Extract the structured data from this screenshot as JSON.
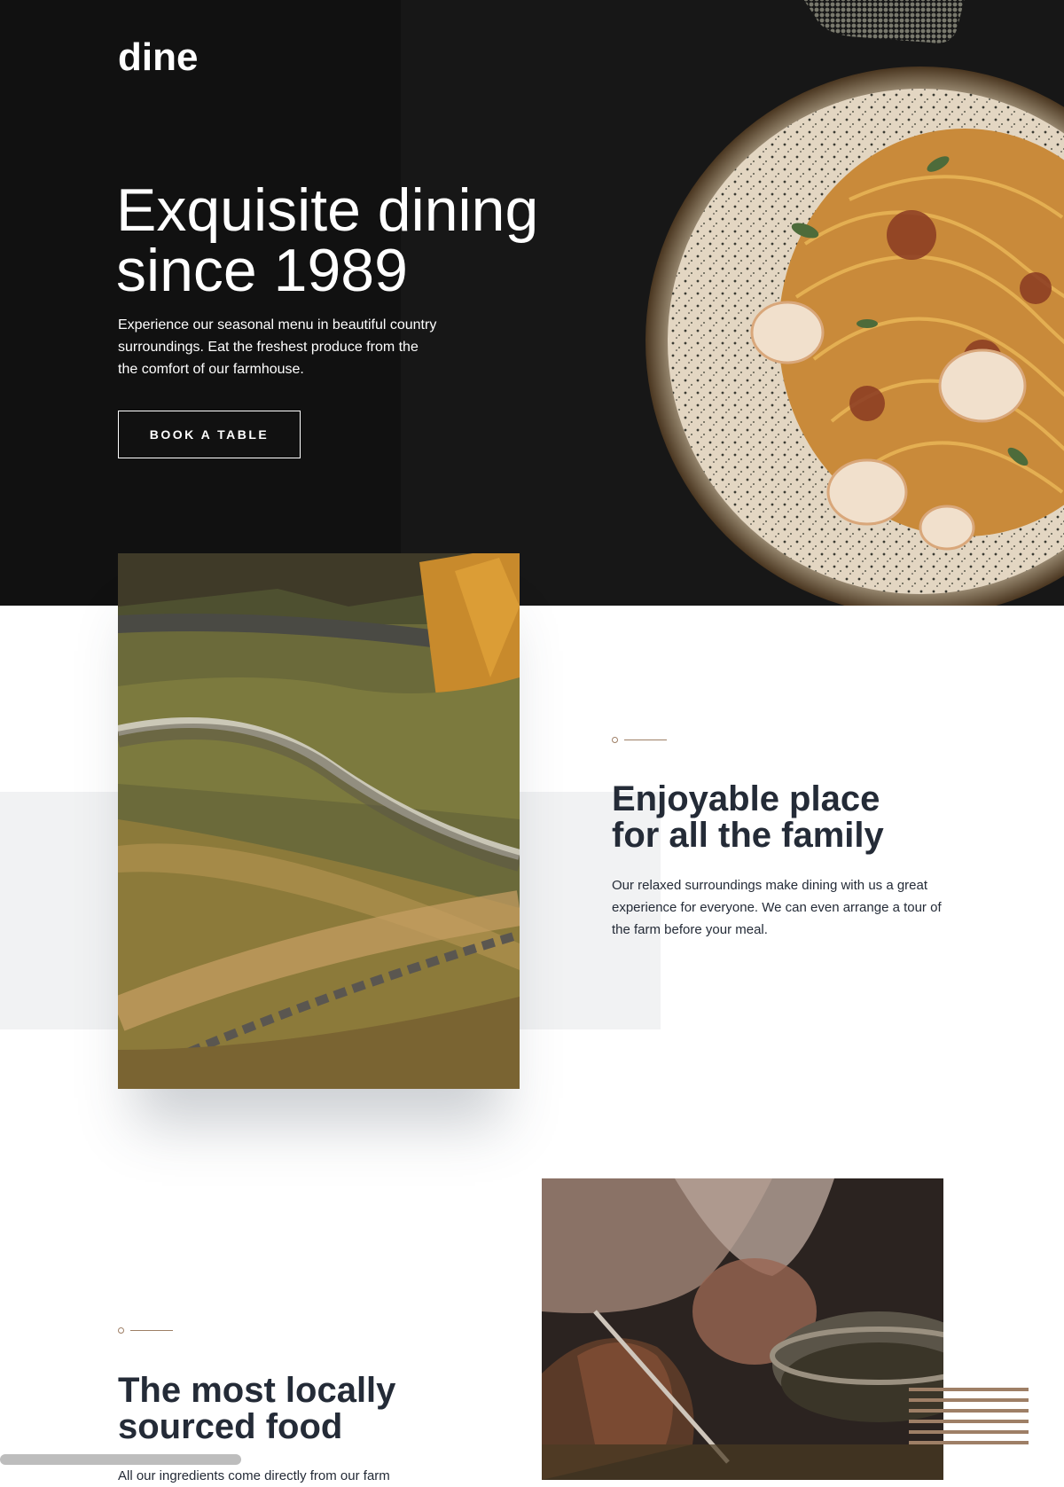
{
  "header": {
    "logo": "dine"
  },
  "hero": {
    "title_line1": "Exquisite dining",
    "title_line2": "since 1989",
    "description": "Experience our seasonal menu in beautiful country surroundings. Eat the freshest produce from the the comfort of our farmhouse.",
    "cta_label": "BOOK A TABLE"
  },
  "family": {
    "heading_line1": "Enjoyable place",
    "heading_line2": "for all the family",
    "description": "Our relaxed surroundings make dining with us a great experience for everyone. We can even arrange a tour of the farm before your meal."
  },
  "local": {
    "heading_line1": "The most locally",
    "heading_line2": "sourced food",
    "description_partial": "All our ingredients come directly from our farm"
  },
  "colors": {
    "hero_bg": "#171717",
    "accent_beige": "#9E7F66",
    "heading_dark": "#242B37",
    "band_gray": "#F1F2F3"
  },
  "icons": [
    "pasta-plate-image",
    "landscape-photo",
    "chef-cooking-photo",
    "dot-pattern-decoration",
    "stripes-decoration"
  ]
}
